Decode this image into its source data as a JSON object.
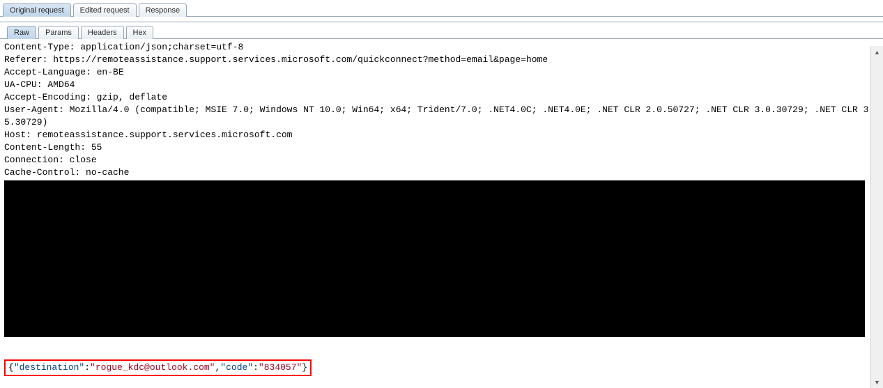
{
  "top_tabs": {
    "original": "Original request",
    "edited": "Edited request",
    "response": "Response"
  },
  "sub_tabs": {
    "raw": "Raw",
    "params": "Params",
    "headers": "Headers",
    "hex": "Hex"
  },
  "request_lines": [
    "Content-Type: application/json;charset=utf-8",
    "Referer: https://remoteassistance.support.services.microsoft.com/quickconnect?method=email&page=home",
    "Accept-Language: en-BE",
    "UA-CPU: AMD64",
    "Accept-Encoding: gzip, deflate",
    "User-Agent: Mozilla/4.0 (compatible; MSIE 7.0; Windows NT 10.0; Win64; x64; Trident/7.0; .NET4.0C; .NET4.0E; .NET CLR 2.0.50727; .NET CLR 3.0.30729; .NET CLR 3.5.30729)",
    "Host: remoteassistance.support.services.microsoft.com",
    "Content-Length: 55",
    "Connection: close",
    "Cache-Control: no-cache"
  ],
  "body": {
    "open": "{",
    "k1": "\"destination\"",
    "colon1": ":",
    "v1": "\"rogue_kdc@outlook.com\"",
    "comma": ",",
    "k2": "\"code\"",
    "colon2": ":",
    "v2": "\"834057\"",
    "close": "}"
  }
}
